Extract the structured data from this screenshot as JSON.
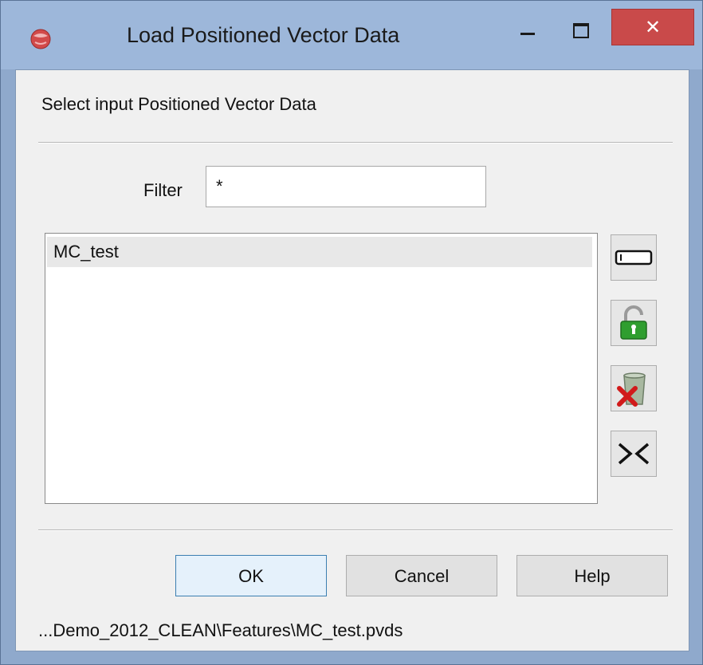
{
  "window": {
    "title": "Load Positioned Vector Data",
    "close_symbol": "✕",
    "app_icon": "red-globe-icon"
  },
  "prompt": "Select input Positioned Vector Data",
  "filter": {
    "label": "Filter",
    "value": "*"
  },
  "list": {
    "items": [
      "MC_test"
    ]
  },
  "side_buttons": [
    {
      "icon": "rename-field-icon"
    },
    {
      "icon": "unlock-padlock-icon"
    },
    {
      "icon": "delete-trash-icon"
    },
    {
      "icon": "collapse-arrows-icon"
    }
  ],
  "buttons": {
    "ok": "OK",
    "cancel": "Cancel",
    "help": "Help"
  },
  "status_path": "...Demo_2012_CLEAN\\Features\\MC_test.pvds",
  "colors": {
    "title_bar": "#9db7da",
    "close_button": "#c94a4a",
    "lock_green": "#2f9e2f",
    "delete_red": "#d11a1a"
  }
}
